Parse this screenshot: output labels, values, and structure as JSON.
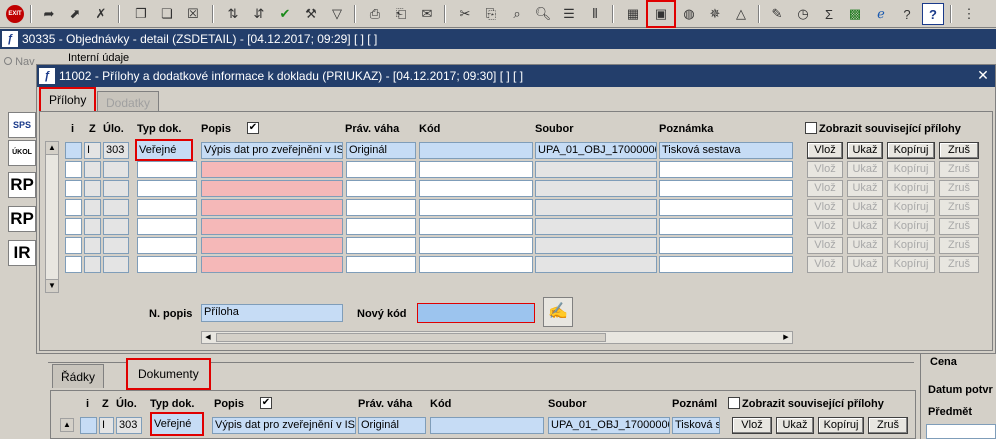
{
  "toolbar": {
    "exit_label": "EXIT"
  },
  "main_window": {
    "title": "30335 - Objednávky - detail (ZSDETAIL) - [04.12.2017; 09:29]  [ ]  [ ]",
    "nav_label": "Nav",
    "internal_label": "Interní údaje"
  },
  "sidebar": {
    "items": [
      "SPS",
      "ÚKOL",
      "RP",
      "RP",
      "IR"
    ]
  },
  "dialog": {
    "title": "11002 - Přílohy a dodatkové informace k dokladu (PRIUKAZ) - [04.12.2017; 09:30]  [ ]  [ ]",
    "tabs": [
      {
        "label": "Přílohy",
        "active": true
      },
      {
        "label": "Dodatky",
        "active": false
      }
    ],
    "columns": {
      "i": "i",
      "z": "Z",
      "ulo": "Úlo.",
      "typ": "Typ dok.",
      "popis": "Popis",
      "prav": "Práv. váha",
      "kod": "Kód",
      "soubor": "Soubor",
      "poznamka": "Poznámka"
    },
    "show_related_label": "Zobrazit související přílohy",
    "row1": {
      "z": "I",
      "ulo": "303",
      "typ": "Veřejné",
      "popis": "Výpis dat pro zveřejnění v IS",
      "prav": "Originál",
      "kod": "",
      "soubor": "UPA_01_OBJ_17000000",
      "poznamka": "Tisková sestava"
    },
    "buttons": {
      "vloz": "Vlož",
      "ukaz": "Ukaž",
      "kopiruj": "Kopíruj",
      "zrus": "Zruš"
    },
    "n_popis_label": "N. popis",
    "n_popis_value": "Příloha",
    "novy_kod_label": "Nový kód",
    "novy_kod_value": ""
  },
  "lower": {
    "tabs": [
      {
        "label": "Řádky",
        "active": false
      },
      {
        "label": "Dokumenty",
        "active": true
      }
    ],
    "columns": {
      "i": "i",
      "z": "Z",
      "ulo": "Úlo.",
      "typ": "Typ dok.",
      "popis": "Popis",
      "prav": "Práv. váha",
      "kod": "Kód",
      "soubor": "Soubor",
      "poznamka": "Poznáml"
    },
    "show_related_label": "Zobrazit související přílohy",
    "row1": {
      "z": "I",
      "ulo": "303",
      "typ": "Veřejné",
      "popis": "Výpis dat pro zveřejnění v IS",
      "prav": "Originál",
      "kod": "",
      "soubor": "UPA_01_OBJ_17000000",
      "poznamka": "Tisková s"
    },
    "buttons": {
      "vloz": "Vlož",
      "ukaz": "Ukaž",
      "kopiruj": "Kopíruj",
      "zrus": "Zruš"
    }
  },
  "right_panel": {
    "cena": "Cena",
    "datum": "Datum potvr",
    "predmet": "Předmět"
  }
}
